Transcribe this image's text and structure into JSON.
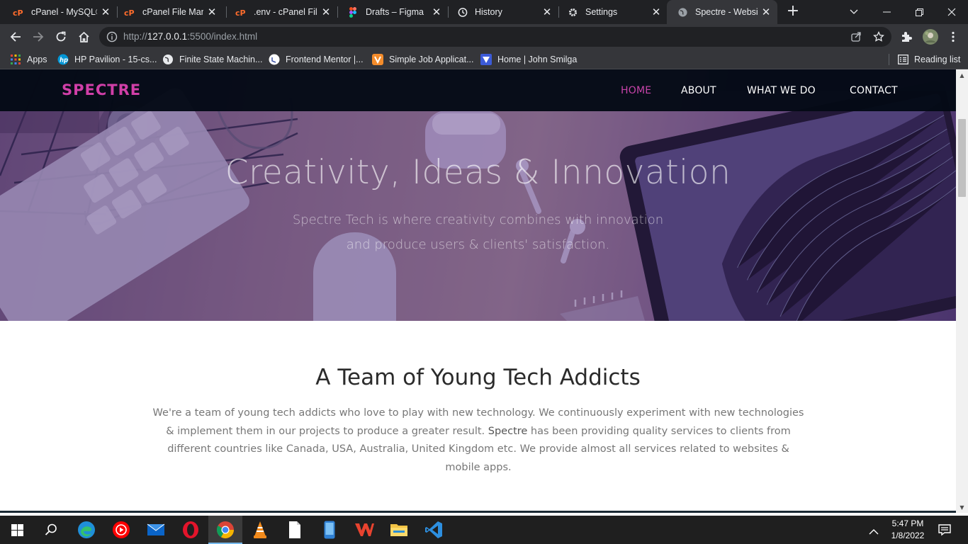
{
  "browser": {
    "tabs": [
      {
        "title": "cPanel - MySQL®",
        "icon": "cpanel-icon"
      },
      {
        "title": "cPanel File Manag",
        "icon": "cpanel-icon"
      },
      {
        "title": ".env - cPanel File",
        "icon": "cpanel-icon"
      },
      {
        "title": "Drafts – Figma",
        "icon": "figma-icon"
      },
      {
        "title": "History",
        "icon": "history-icon"
      },
      {
        "title": "Settings",
        "icon": "gear-icon"
      },
      {
        "title": "Spectre - Websit",
        "icon": "globe-icon",
        "active": true
      }
    ],
    "url_scheme": "http://",
    "url_host": "127.0.0.1",
    "url_rest": ":5500/index.html",
    "bookmarks": [
      {
        "label": "Apps",
        "icon": "apps-grid-icon"
      },
      {
        "label": "HP Pavilion - 15-cs...",
        "icon": "hp-icon"
      },
      {
        "label": "Finite State Machin...",
        "icon": "globe-icon"
      },
      {
        "label": "Frontend Mentor |...",
        "icon": "frontend-mentor-icon"
      },
      {
        "label": "Simple Job Applicat...",
        "icon": "job-app-icon"
      },
      {
        "label": "Home | John Smilga",
        "icon": "smilga-icon"
      }
    ],
    "reading_list": "Reading list"
  },
  "site": {
    "logo": "SPECTRE",
    "nav": [
      {
        "label": "HOME",
        "active": true
      },
      {
        "label": "ABOUT"
      },
      {
        "label": "WHAT WE DO"
      },
      {
        "label": "CONTACT"
      }
    ],
    "hero": {
      "title": "Creativity, Ideas & Innovation",
      "subtitle_line1": "Spectre Tech is where creativity combines with innovation",
      "subtitle_line2": "and produce users & clients' satisfaction."
    },
    "about": {
      "heading": "A Team of Young Tech Addicts",
      "text_before": "We're a team of young tech addicts who love to play with new technology. We continuously experiment with new technologies & implement them in our projects to produce a greater result. ",
      "text_bold": "Spectre",
      "text_after": " has been providing quality services to clients from different countries like Canada, USA, Australia, United Kingdom etc. We provide almost all services related to websites & mobile apps."
    }
  },
  "taskbar": {
    "apps": [
      "start-icon",
      "search-icon",
      "edge-icon",
      "youtube-music-icon",
      "mail-icon",
      "opera-icon",
      "chrome-icon",
      "vlc-icon",
      "notepad-icon",
      "phone-app-icon",
      "wps-office-icon",
      "file-explorer-icon",
      "vscode-icon"
    ],
    "time": "5:47 PM",
    "date": "1/8/2022"
  },
  "colors": {
    "accent": "#c743a9",
    "logo": "#d13fa8",
    "nav_bg": "#040a16",
    "chrome_dark": "#202124",
    "chrome_toolbar": "#35363a"
  }
}
